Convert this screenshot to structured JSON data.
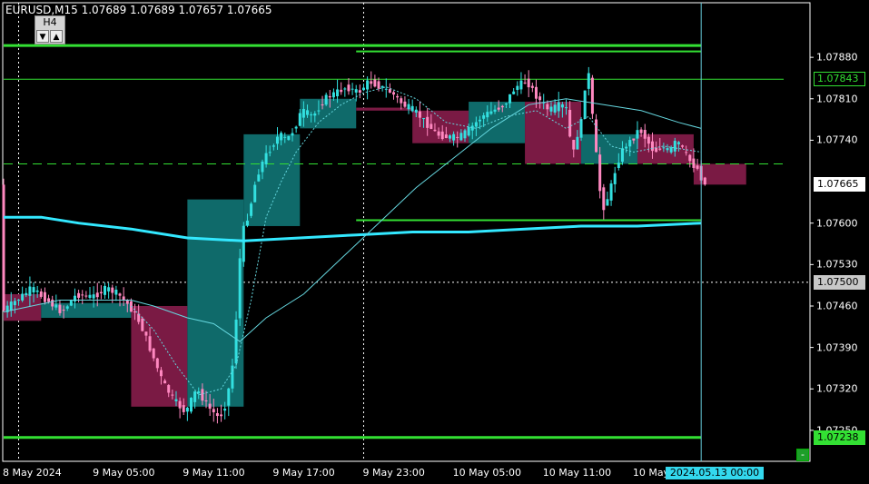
{
  "header": {
    "symbol": "EURUSD,M15",
    "ohlc": "1.07689 1.07689 1.07657 1.07665"
  },
  "timeframe_widget": {
    "label": "H4",
    "down_arrow": "▼",
    "up_arrow": "▲"
  },
  "minus_button_label": "-",
  "colors": {
    "background": "#000000",
    "bull_candle": "#33e0e0",
    "bear_candle": "#ff88c0",
    "bull_h4_box": "#0f6a6a",
    "bear_h4_box": "#7a1a44",
    "level_green": "#33e033",
    "ma_slow": "#33e8ff",
    "ma_fast": "#66d8e0",
    "grid_vertical": "#ffffff"
  },
  "price_labels": [
    {
      "value": "1.07843",
      "price": 1.07843,
      "bg": "#000000",
      "fg": "#33e033",
      "border": "#33e033"
    },
    {
      "value": "1.07665",
      "price": 1.07665,
      "bg": "#ffffff",
      "fg": "#000000",
      "border": "#ffffff"
    },
    {
      "value": "1.07500",
      "price": 1.075,
      "bg": "#c8c8c8",
      "fg": "#000000",
      "border": "#c8c8c8"
    },
    {
      "value": "1.07238",
      "price": 1.07238,
      "bg": "#33e033",
      "fg": "#000000",
      "border": "#33e033"
    }
  ],
  "time_label": "2024.05.13 00:00",
  "chart_data": {
    "type": "candlestick",
    "title": "EURUSD,M15",
    "ylim": [
      1.0721,
      1.0794
    ],
    "y_ticks": [
      {
        "label": "1.07880",
        "value": 1.0788
      },
      {
        "label": "1.07810",
        "value": 1.0781
      },
      {
        "label": "1.07740",
        "value": 1.0774
      },
      {
        "label": "1.07600",
        "value": 1.076
      },
      {
        "label": "1.07530",
        "value": 1.0753
      },
      {
        "label": "1.07460",
        "value": 1.0746
      },
      {
        "label": "1.07390",
        "value": 1.0739
      },
      {
        "label": "1.07320",
        "value": 1.0732
      },
      {
        "label": "1.07250",
        "value": 1.0725
      }
    ],
    "x_ticks": [
      {
        "label": "8 May 2024",
        "x": 0
      },
      {
        "label": "9 May 05:00",
        "x": 24
      },
      {
        "label": "9 May 11:00",
        "x": 48
      },
      {
        "label": "9 May 17:00",
        "x": 72
      },
      {
        "label": "9 May 23:00",
        "x": 96
      },
      {
        "label": "10 May 05:00",
        "x": 120
      },
      {
        "label": "10 May 11:00",
        "x": 144
      },
      {
        "label": "10 May 17:",
        "x": 168
      }
    ],
    "h4_boxes": [
      {
        "x0": 0,
        "x1": 10,
        "open": 1.0748,
        "close": 1.07435,
        "dir": "bear"
      },
      {
        "x0": 10,
        "x1": 34,
        "open": 1.0744,
        "close": 1.07465,
        "dir": "bull"
      },
      {
        "x0": 34,
        "x1": 49,
        "open": 1.0746,
        "close": 1.0729,
        "dir": "bear"
      },
      {
        "x0": 49,
        "x1": 64,
        "open": 1.0729,
        "close": 1.0764,
        "dir": "bull"
      },
      {
        "x0": 64,
        "x1": 79,
        "open": 1.07595,
        "close": 1.0775,
        "dir": "bull"
      },
      {
        "x0": 79,
        "x1": 94,
        "open": 1.0776,
        "close": 1.0781,
        "dir": "bull"
      },
      {
        "x0": 94,
        "x1": 109,
        "open": 1.07795,
        "close": 1.0779,
        "dir": "bear"
      },
      {
        "x0": 109,
        "x1": 124,
        "open": 1.0779,
        "close": 1.07735,
        "dir": "bear"
      },
      {
        "x0": 124,
        "x1": 139,
        "open": 1.07735,
        "close": 1.07805,
        "dir": "bull"
      },
      {
        "x0": 139,
        "x1": 154,
        "open": 1.07805,
        "close": 1.077,
        "dir": "bear"
      },
      {
        "x0": 154,
        "x1": 169,
        "open": 1.077,
        "close": 1.0775,
        "dir": "bull"
      },
      {
        "x0": 169,
        "x1": 184,
        "open": 1.0775,
        "close": 1.077,
        "dir": "bear"
      },
      {
        "x0": 184,
        "x1": 198,
        "open": 1.077,
        "close": 1.07665,
        "dir": "bear"
      }
    ],
    "close_path": [
      [
        0,
        1.0745
      ],
      [
        4,
        1.0747
      ],
      [
        8,
        1.0749
      ],
      [
        12,
        1.0747
      ],
      [
        16,
        1.0745
      ],
      [
        20,
        1.0748
      ],
      [
        24,
        1.07475
      ],
      [
        28,
        1.0749
      ],
      [
        31,
        1.0748
      ],
      [
        34,
        1.0746
      ],
      [
        37,
        1.0743
      ],
      [
        40,
        1.0738
      ],
      [
        43,
        1.0733
      ],
      [
        46,
        1.073
      ],
      [
        49,
        1.0728
      ],
      [
        52,
        1.0732
      ],
      [
        55,
        1.0729
      ],
      [
        58,
        1.0727
      ],
      [
        60,
        1.073
      ],
      [
        62,
        1.0738
      ],
      [
        63,
        1.075
      ],
      [
        64,
        1.0758
      ],
      [
        66,
        1.0762
      ],
      [
        68,
        1.0768
      ],
      [
        70,
        1.0771
      ],
      [
        72,
        1.0773
      ],
      [
        74,
        1.0775
      ],
      [
        76,
        1.0774
      ],
      [
        78,
        1.0776
      ],
      [
        80,
        1.0779
      ],
      [
        83,
        1.0778
      ],
      [
        86,
        1.0781
      ],
      [
        89,
        1.0782
      ],
      [
        92,
        1.0783
      ],
      [
        95,
        1.0782
      ],
      [
        98,
        1.0784
      ],
      [
        101,
        1.0783
      ],
      [
        104,
        1.0782
      ],
      [
        107,
        1.078
      ],
      [
        110,
        1.0779
      ],
      [
        113,
        1.0777
      ],
      [
        116,
        1.0775
      ],
      [
        119,
        1.07745
      ],
      [
        122,
        1.07745
      ],
      [
        125,
        1.0776
      ],
      [
        128,
        1.0778
      ],
      [
        131,
        1.0779
      ],
      [
        134,
        1.078
      ],
      [
        137,
        1.0783
      ],
      [
        140,
        1.0784
      ],
      [
        143,
        1.0781
      ],
      [
        146,
        1.0779
      ],
      [
        149,
        1.078
      ],
      [
        151,
        1.0779
      ],
      [
        152,
        1.077
      ],
      [
        153,
        1.0774
      ],
      [
        155,
        1.0778
      ],
      [
        156,
        1.0788
      ],
      [
        157,
        1.0782
      ],
      [
        158,
        1.0774
      ],
      [
        159,
        1.0769
      ],
      [
        160,
        1.0762
      ],
      [
        162,
        1.0765
      ],
      [
        164,
        1.077
      ],
      [
        166,
        1.0773
      ],
      [
        168,
        1.0774
      ],
      [
        170,
        1.0776
      ],
      [
        172,
        1.0774
      ],
      [
        174,
        1.0772
      ],
      [
        176,
        1.0773
      ],
      [
        178,
        1.0772
      ],
      [
        180,
        1.0774
      ],
      [
        182,
        1.0772
      ],
      [
        184,
        1.077
      ],
      [
        186,
        1.07689
      ],
      [
        187,
        1.07665
      ]
    ],
    "levels": [
      {
        "price": 1.079,
        "x0": 0,
        "x1": 186,
        "width": 3
      },
      {
        "price": 1.0789,
        "x0": 94,
        "x1": 186,
        "width": 2
      },
      {
        "price": 1.07843,
        "x0": 0,
        "x1": 208,
        "width": 1
      },
      {
        "price": 1.077,
        "x0": 0,
        "x1": 208,
        "width": 1,
        "dashed": true
      },
      {
        "price": 1.07605,
        "x0": 94,
        "x1": 186,
        "width": 2
      },
      {
        "price": 1.07238,
        "x0": 0,
        "x1": 186,
        "width": 3
      }
    ],
    "ma_slow": [
      [
        0,
        1.0761
      ],
      [
        10,
        1.0761
      ],
      [
        20,
        1.076
      ],
      [
        34,
        1.0759
      ],
      [
        49,
        1.07575
      ],
      [
        64,
        1.0757
      ],
      [
        79,
        1.07575
      ],
      [
        94,
        1.0758
      ],
      [
        109,
        1.07585
      ],
      [
        124,
        1.07585
      ],
      [
        139,
        1.0759
      ],
      [
        154,
        1.07595
      ],
      [
        169,
        1.07595
      ],
      [
        186,
        1.076
      ]
    ],
    "ma_fast": [
      [
        0,
        1.0745
      ],
      [
        15,
        1.0747
      ],
      [
        34,
        1.0747
      ],
      [
        40,
        1.0746
      ],
      [
        49,
        1.0744
      ],
      [
        56,
        1.0743
      ],
      [
        63,
        1.074
      ],
      [
        70,
        1.0744
      ],
      [
        80,
        1.0748
      ],
      [
        90,
        1.0754
      ],
      [
        100,
        1.076
      ],
      [
        110,
        1.0766
      ],
      [
        120,
        1.0771
      ],
      [
        130,
        1.0776
      ],
      [
        140,
        1.078
      ],
      [
        150,
        1.0781
      ],
      [
        160,
        1.078
      ],
      [
        170,
        1.0779
      ],
      [
        180,
        1.0777
      ],
      [
        186,
        1.0776
      ]
    ],
    "ma_dotted": [
      [
        34,
        1.0746
      ],
      [
        40,
        1.0742
      ],
      [
        46,
        1.0736
      ],
      [
        52,
        1.0731
      ],
      [
        58,
        1.0732
      ],
      [
        62,
        1.0736
      ],
      [
        66,
        1.0747
      ],
      [
        70,
        1.0761
      ],
      [
        74,
        1.0767
      ],
      [
        78,
        1.0772
      ],
      [
        84,
        1.0777
      ],
      [
        90,
        1.078
      ],
      [
        96,
        1.0782
      ],
      [
        102,
        1.0783
      ],
      [
        110,
        1.0781
      ],
      [
        118,
        1.0777
      ],
      [
        126,
        1.0776
      ],
      [
        134,
        1.0778
      ],
      [
        142,
        1.0779
      ],
      [
        150,
        1.0776
      ],
      [
        156,
        1.0778
      ],
      [
        162,
        1.0773
      ],
      [
        168,
        1.0772
      ],
      [
        176,
        1.0773
      ],
      [
        186,
        1.0772
      ]
    ],
    "vertical_marker_x": 186
  }
}
